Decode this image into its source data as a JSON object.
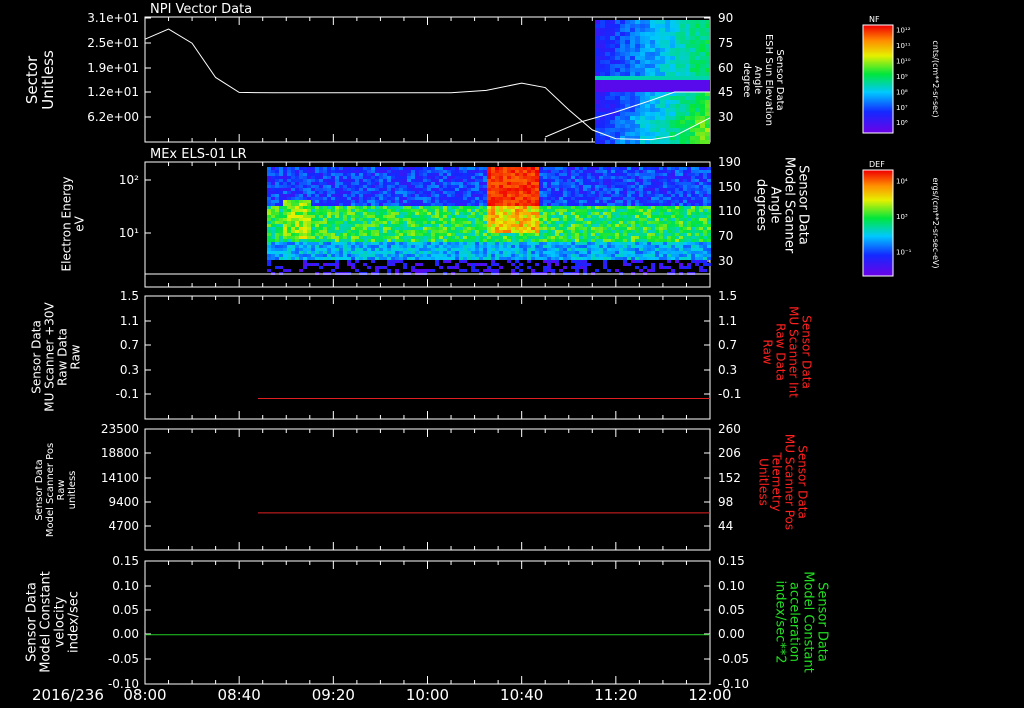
{
  "time_axis": {
    "date": "2016/236",
    "ticks": [
      "08:00",
      "08:40",
      "09:20",
      "10:00",
      "10:40",
      "11:20",
      "12:00"
    ]
  },
  "panels": [
    {
      "title": "NPI Vector Data",
      "left_label": [
        "Sector",
        "Unitless"
      ],
      "right_label": [
        "Sensor Data",
        "ESH Sun Elevation",
        "Angle",
        "degree"
      ],
      "left_ticks": [
        "3.1e+01",
        "2.5e+01",
        "1.9e+01",
        "1.2e+01",
        "6.2e+00"
      ],
      "right_ticks": [
        "90",
        "75",
        "60",
        "45",
        "30"
      ]
    },
    {
      "title": "MEx ELS-01 LR",
      "left_label": [
        "Electron Energy",
        "eV"
      ],
      "right_label": [
        "Sensor Data",
        "Model Scanner",
        "Angle",
        "degrees"
      ],
      "left_ticks": [
        "10²",
        "10¹"
      ],
      "right_ticks": [
        "190",
        "150",
        "110",
        "70",
        "30"
      ]
    },
    {
      "title": "",
      "left_label": [
        "Sensor Data",
        "MU Scanner +30V",
        "Raw Data",
        "Raw"
      ],
      "right_label": [
        "Sensor Data",
        "MU Scanner Int",
        "Raw Data",
        "Raw"
      ],
      "left_ticks": [
        "1.5",
        "1.1",
        "0.7",
        "0.3",
        "-0.1"
      ],
      "right_ticks": [
        "1.5",
        "1.1",
        "0.7",
        "0.3",
        "-0.1"
      ]
    },
    {
      "title": "",
      "left_label": [
        "Sensor Data",
        "Model Scanner Pos",
        "Raw",
        "unitless"
      ],
      "right_label": [
        "Sensor Data",
        "MU Scanner Pos",
        "Telemetry",
        "Unitless"
      ],
      "left_ticks": [
        "23500",
        "18800",
        "14100",
        "9400",
        "4700"
      ],
      "right_ticks": [
        "260",
        "206",
        "152",
        "98",
        "44"
      ]
    },
    {
      "title": "",
      "left_label": [
        "Sensor Data",
        "Model Constant",
        "velocity",
        "index/sec"
      ],
      "right_label": [
        "Sensor Data",
        "Model Constant",
        "acceleration",
        "index/sec**2"
      ],
      "left_ticks": [
        "0.15",
        "0.10",
        "0.05",
        "0.00",
        "-0.05",
        "-0.10"
      ],
      "right_ticks": [
        "0.15",
        "0.10",
        "0.05",
        "0.00",
        "-0.05",
        "-0.10"
      ]
    }
  ],
  "colorbars": [
    {
      "label": "NF",
      "unit": "cnts/(cm**2-sr-sec)",
      "ticks": [
        "10¹²",
        "10¹¹",
        "10¹⁰",
        "10⁹",
        "10⁸",
        "10⁷",
        "10⁶"
      ]
    },
    {
      "label": "DEF",
      "unit": "ergs/(cm**2-sr-sec-eV)",
      "ticks": [
        "10⁴",
        "10³",
        "10⁻¹"
      ]
    }
  ],
  "colors": {
    "background": "#000000",
    "axes": "#ffffff",
    "panel3_line": "#e02020",
    "panel4_line": "#e02020",
    "panel5_line": "#22cc22",
    "panel3_right_label": "#ff2020",
    "panel4_right_label": "#ff2020",
    "panel5_right_label": "#22dd22"
  },
  "chart_data": [
    {
      "type": "line",
      "title": "NPI Vector Data",
      "x_range": [
        "08:00",
        "12:00"
      ],
      "ylim": [
        0,
        31
      ],
      "series": [
        {
          "x": [
            0,
            10,
            20,
            30,
            40,
            55,
            80,
            110,
            130,
            145,
            160,
            170,
            180,
            190,
            200,
            215,
            225,
            240
          ],
          "values": [
            25.5,
            28,
            24.5,
            16,
            12.3,
            12.2,
            12.2,
            12.2,
            12.2,
            12.8,
            14.6,
            13.5,
            8,
            3,
            0.8,
            0.6,
            1.5,
            6
          ]
        }
      ],
      "overlay_series": {
        "right_axis_range": [
          15,
          90
        ],
        "x": [
          170,
          185,
          200,
          215,
          225,
          240
        ],
        "values": [
          18,
          27,
          33,
          40,
          45,
          45
        ]
      }
    },
    {
      "type": "heatmap",
      "title": "MEx ELS-01 LR",
      "x_range": [
        "08:00",
        "12:00"
      ],
      "data_start": "08:56"
    },
    {
      "type": "line",
      "x_range": [
        "08:00",
        "12:00"
      ],
      "ylim": [
        -0.3,
        1.5
      ],
      "series": [
        {
          "x": [
            48,
            240
          ],
          "values": [
            0.0,
            0.0
          ]
        }
      ]
    },
    {
      "type": "line",
      "x_range": [
        "08:00",
        "12:00"
      ],
      "ylim": [
        0,
        23500
      ],
      "series": [
        {
          "x": [
            48,
            240
          ],
          "values": [
            7200,
            7200
          ]
        }
      ]
    },
    {
      "type": "line",
      "x_range": [
        "08:00",
        "12:00"
      ],
      "ylim": [
        -0.1,
        0.15
      ],
      "series": [
        {
          "x": [
            0,
            240
          ],
          "values": [
            0.0,
            0.0
          ]
        }
      ]
    }
  ]
}
